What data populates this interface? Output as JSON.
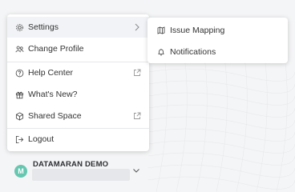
{
  "menu": {
    "items": [
      {
        "label": "Settings",
        "icon": "gear-icon",
        "right_icon": "chevron-right-icon"
      },
      {
        "label": "Change Profile",
        "icon": "users-icon"
      },
      {
        "label": "Help Center",
        "icon": "question-circle-icon",
        "right_icon": "external-link-icon"
      },
      {
        "label": "What's New?",
        "icon": "gift-icon"
      },
      {
        "label": "Shared Space",
        "icon": "cube-icon",
        "right_icon": "external-link-icon"
      },
      {
        "label": "Logout",
        "icon": "logout-icon"
      }
    ]
  },
  "submenu": {
    "items": [
      {
        "label": "Issue Mapping",
        "icon": "map-icon"
      },
      {
        "label": "Notifications",
        "icon": "bell-icon"
      }
    ]
  },
  "user": {
    "initial": "M",
    "name": "DATAMARAN DEMO",
    "avatar_color": "#66c7b0"
  }
}
